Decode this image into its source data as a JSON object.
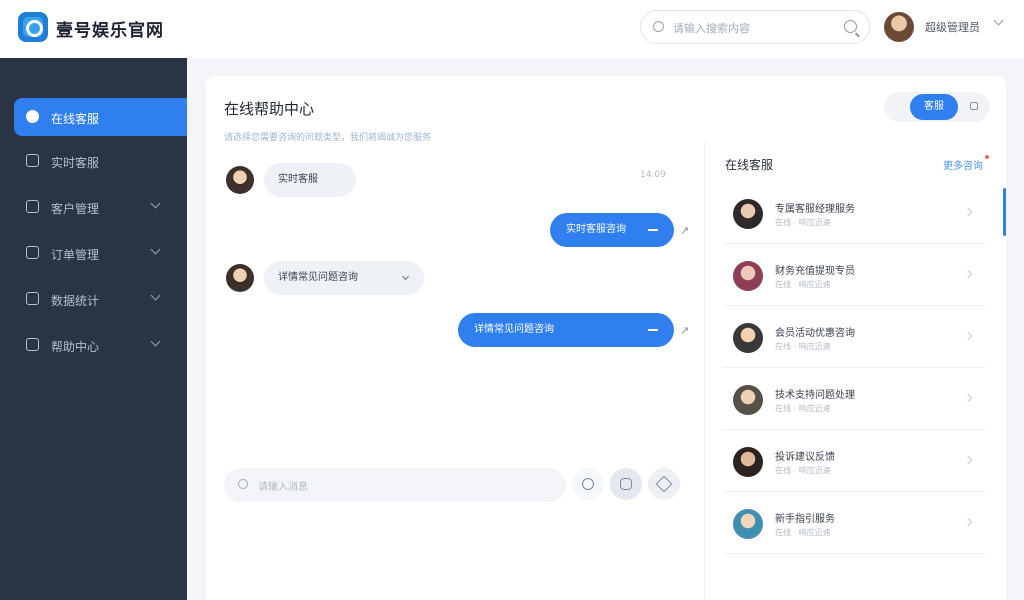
{
  "header": {
    "brand": "壹号娱乐官网",
    "search_placeholder": "请输入搜索内容",
    "user_name": "超级管理员"
  },
  "sidebar": {
    "items": [
      {
        "label": "在线客服",
        "icon": "chat-icon",
        "active": true
      },
      {
        "label": "实时客服",
        "icon": "home-icon"
      },
      {
        "label": "客户管理",
        "icon": "user-icon"
      },
      {
        "label": "订单管理",
        "icon": "order-icon"
      },
      {
        "label": "数据统计",
        "icon": "chart-icon"
      },
      {
        "label": "帮助中心",
        "icon": "help-icon"
      }
    ]
  },
  "main": {
    "title": "在线帮助中心",
    "subtitle": "请选择您需要咨询的问题类型，我们将竭诚为您服务",
    "segment_label": "客服",
    "timestamp": "14:09",
    "messages": [
      {
        "side": "left",
        "text": "实时客服"
      },
      {
        "side": "right",
        "text": "实时客服咨询"
      },
      {
        "side": "left",
        "text": "详情常见问题咨询"
      },
      {
        "side": "right",
        "text": "详情常见问题咨询"
      }
    ],
    "input_placeholder": "请输入消息"
  },
  "agents": {
    "title": "在线客服",
    "link": "更多咨询",
    "items": [
      {
        "name": "专属客服经理服务",
        "meta": "在线 · 响应迅速"
      },
      {
        "name": "财务充值提现专员",
        "meta": "在线 · 响应迅速"
      },
      {
        "name": "会员活动优惠咨询",
        "meta": "在线 · 响应迅速"
      },
      {
        "name": "技术支持问题处理",
        "meta": "在线 · 响应迅速"
      },
      {
        "name": "投诉建议反馈",
        "meta": "在线 · 响应迅速"
      },
      {
        "name": "新手指引服务",
        "meta": "在线 · 响应迅速"
      }
    ]
  },
  "colors": {
    "accent": "#2f7fef",
    "sidebar": "#2b3445"
  }
}
